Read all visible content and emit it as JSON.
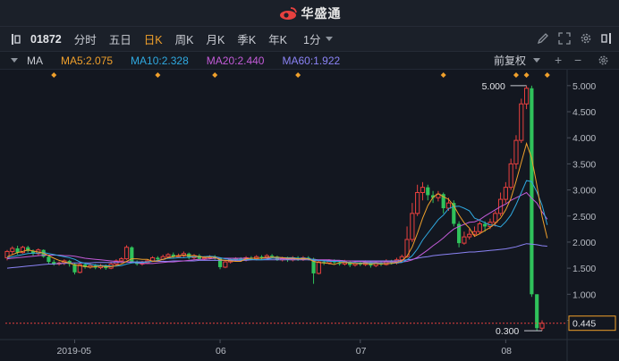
{
  "app": {
    "brand_name": "华盛通"
  },
  "toolbar": {
    "code": "01872",
    "timeframes": [
      "分时",
      "五日",
      "日K",
      "周K",
      "月K",
      "季K",
      "年K"
    ],
    "active_timeframe": "日K",
    "interval": "1分"
  },
  "indicator_bar": {
    "title": "MA",
    "ma5": "MA5:2.075",
    "ma10": "MA10:2.328",
    "ma20": "MA20:2.440",
    "ma60": "MA60:1.922",
    "adjust": "前复权",
    "plus": "+",
    "minus": "−"
  },
  "colors": {
    "up": "#e8413f",
    "down": "#30c25b",
    "ma5": "#f0a02b",
    "ma10": "#2fa9e0",
    "ma20": "#c35bd8",
    "ma60": "#8b83f5",
    "marker": "#f0a02b"
  },
  "chart_data": {
    "type": "candlestick",
    "x_ticks": [
      "2019-05",
      "06",
      "07",
      "08"
    ],
    "y_ticks": [
      "5.000",
      "4.500",
      "4.000",
      "3.500",
      "3.000",
      "2.500",
      "2.000",
      "1.500",
      "1.000",
      "0.500"
    ],
    "ylim": [
      0.2,
      5.1
    ],
    "high_label": "5.000",
    "low_label": "0.300",
    "last_price": "0.445",
    "candles": [
      [
        1.7,
        1.82,
        1.85,
        1.65
      ],
      [
        1.82,
        1.88,
        1.92,
        1.75
      ],
      [
        1.88,
        1.8,
        1.93,
        1.76
      ],
      [
        1.8,
        1.9,
        1.93,
        1.78
      ],
      [
        1.9,
        1.83,
        1.93,
        1.8
      ],
      [
        1.83,
        1.78,
        1.86,
        1.74
      ],
      [
        1.78,
        1.85,
        1.88,
        1.74
      ],
      [
        1.85,
        1.72,
        1.86,
        1.7
      ],
      [
        1.72,
        1.62,
        1.75,
        1.58
      ],
      [
        1.62,
        1.58,
        1.66,
        1.55
      ],
      [
        1.58,
        1.6,
        1.63,
        1.55
      ],
      [
        1.6,
        1.64,
        1.67,
        1.56
      ],
      [
        1.64,
        1.58,
        1.66,
        1.53
      ],
      [
        1.58,
        1.42,
        1.6,
        1.38
      ],
      [
        1.42,
        1.57,
        1.61,
        1.4
      ],
      [
        1.57,
        1.52,
        1.6,
        1.49
      ],
      [
        1.52,
        1.55,
        1.59,
        1.49
      ],
      [
        1.55,
        1.51,
        1.58,
        1.48
      ],
      [
        1.51,
        1.55,
        1.58,
        1.48
      ],
      [
        1.55,
        1.5,
        1.57,
        1.47
      ],
      [
        1.5,
        1.58,
        1.62,
        1.48
      ],
      [
        1.58,
        1.64,
        1.67,
        1.55
      ],
      [
        1.64,
        1.68,
        1.71,
        1.6
      ],
      [
        1.68,
        1.9,
        1.94,
        1.66
      ],
      [
        1.9,
        1.62,
        1.92,
        1.6
      ],
      [
        1.62,
        1.58,
        1.65,
        1.55
      ],
      [
        1.58,
        1.6,
        1.64,
        1.55
      ],
      [
        1.6,
        1.64,
        1.67,
        1.58
      ],
      [
        1.64,
        1.7,
        1.73,
        1.62
      ],
      [
        1.7,
        1.67,
        1.73,
        1.64
      ],
      [
        1.67,
        1.72,
        1.76,
        1.65
      ],
      [
        1.72,
        1.76,
        1.79,
        1.69
      ],
      [
        1.76,
        1.72,
        1.8,
        1.7
      ],
      [
        1.72,
        1.74,
        1.78,
        1.7
      ],
      [
        1.74,
        1.78,
        1.82,
        1.71
      ],
      [
        1.78,
        1.7,
        1.8,
        1.67
      ],
      [
        1.7,
        1.74,
        1.77,
        1.67
      ],
      [
        1.74,
        1.68,
        1.77,
        1.66
      ],
      [
        1.68,
        1.7,
        1.73,
        1.65
      ],
      [
        1.7,
        1.72,
        1.75,
        1.67
      ],
      [
        1.72,
        1.69,
        1.75,
        1.66
      ],
      [
        1.69,
        1.52,
        1.7,
        1.48
      ],
      [
        1.52,
        1.62,
        1.66,
        1.5
      ],
      [
        1.62,
        1.66,
        1.69,
        1.59
      ],
      [
        1.66,
        1.68,
        1.71,
        1.63
      ],
      [
        1.68,
        1.66,
        1.71,
        1.63
      ],
      [
        1.66,
        1.7,
        1.73,
        1.63
      ],
      [
        1.7,
        1.68,
        1.73,
        1.65
      ],
      [
        1.68,
        1.72,
        1.75,
        1.65
      ],
      [
        1.72,
        1.7,
        1.75,
        1.67
      ],
      [
        1.7,
        1.74,
        1.77,
        1.67
      ],
      [
        1.74,
        1.72,
        1.77,
        1.69
      ],
      [
        1.72,
        1.66,
        1.74,
        1.64
      ],
      [
        1.66,
        1.69,
        1.72,
        1.63
      ],
      [
        1.69,
        1.66,
        1.72,
        1.62
      ],
      [
        1.66,
        1.7,
        1.73,
        1.63
      ],
      [
        1.7,
        1.67,
        1.73,
        1.64
      ],
      [
        1.67,
        1.7,
        1.73,
        1.64
      ],
      [
        1.7,
        1.68,
        1.73,
        1.65
      ],
      [
        1.68,
        1.4,
        1.7,
        1.2
      ],
      [
        1.4,
        1.62,
        1.66,
        1.38
      ],
      [
        1.62,
        1.6,
        1.65,
        1.56
      ],
      [
        1.6,
        1.64,
        1.67,
        1.57
      ],
      [
        1.64,
        1.61,
        1.67,
        1.58
      ],
      [
        1.61,
        1.58,
        1.64,
        1.55
      ],
      [
        1.58,
        1.62,
        1.66,
        1.55
      ],
      [
        1.62,
        1.56,
        1.64,
        1.52
      ],
      [
        1.56,
        1.6,
        1.64,
        1.53
      ],
      [
        1.6,
        1.57,
        1.63,
        1.54
      ],
      [
        1.57,
        1.61,
        1.65,
        1.54
      ],
      [
        1.61,
        1.55,
        1.63,
        1.51
      ],
      [
        1.55,
        1.6,
        1.63,
        1.52
      ],
      [
        1.6,
        1.57,
        1.63,
        1.54
      ],
      [
        1.57,
        1.63,
        1.67,
        1.55
      ],
      [
        1.63,
        1.6,
        1.66,
        1.57
      ],
      [
        1.6,
        1.66,
        1.7,
        1.57
      ],
      [
        1.66,
        1.72,
        1.76,
        1.63
      ],
      [
        1.72,
        2.05,
        2.3,
        1.7
      ],
      [
        2.05,
        2.55,
        2.75,
        2.0
      ],
      [
        2.55,
        2.95,
        3.1,
        2.5
      ],
      [
        2.95,
        3.05,
        3.15,
        2.8
      ],
      [
        3.05,
        2.9,
        3.1,
        2.8
      ],
      [
        2.9,
        2.85,
        2.98,
        2.75
      ],
      [
        2.85,
        2.92,
        2.98,
        2.78
      ],
      [
        2.92,
        2.65,
        2.95,
        2.55
      ],
      [
        2.65,
        2.75,
        2.85,
        2.6
      ],
      [
        2.75,
        2.35,
        2.8,
        2.3
      ],
      [
        2.35,
        1.98,
        2.4,
        1.9
      ],
      [
        1.98,
        2.1,
        2.2,
        1.95
      ],
      [
        2.1,
        2.15,
        2.25,
        2.05
      ],
      [
        2.15,
        2.2,
        2.3,
        2.1
      ],
      [
        2.2,
        2.35,
        2.4,
        2.15
      ],
      [
        2.35,
        2.3,
        2.4,
        2.2
      ],
      [
        2.3,
        2.38,
        2.45,
        2.25
      ],
      [
        2.38,
        2.55,
        2.6,
        2.3
      ],
      [
        2.55,
        2.82,
        2.95,
        2.5
      ],
      [
        2.82,
        3.05,
        3.15,
        2.75
      ],
      [
        3.05,
        3.5,
        3.6,
        3.0
      ],
      [
        3.5,
        3.95,
        4.05,
        3.4
      ],
      [
        3.95,
        4.65,
        4.75,
        3.9
      ],
      [
        4.65,
        4.95,
        5.0,
        4.55
      ],
      [
        4.95,
        1.0,
        5.0,
        0.95
      ],
      [
        1.0,
        0.35,
        1.0,
        0.3
      ],
      [
        0.35,
        0.445,
        0.5,
        0.3
      ]
    ],
    "ma_series": {
      "ma5": [
        1.72,
        1.76,
        1.8,
        1.82,
        1.85,
        1.83,
        1.81,
        1.79,
        1.74,
        1.69,
        1.65,
        1.62,
        1.6,
        1.56,
        1.55,
        1.53,
        1.52,
        1.53,
        1.54,
        1.53,
        1.53,
        1.55,
        1.58,
        1.63,
        1.68,
        1.68,
        1.67,
        1.67,
        1.63,
        1.64,
        1.67,
        1.7,
        1.72,
        1.74,
        1.75,
        1.74,
        1.74,
        1.72,
        1.71,
        1.71,
        1.71,
        1.66,
        1.65,
        1.64,
        1.63,
        1.63,
        1.68,
        1.69,
        1.69,
        1.69,
        1.71,
        1.71,
        1.71,
        1.7,
        1.69,
        1.69,
        1.68,
        1.68,
        1.68,
        1.63,
        1.61,
        1.6,
        1.59,
        1.57,
        1.61,
        1.61,
        1.6,
        1.59,
        1.59,
        1.59,
        1.58,
        1.59,
        1.58,
        1.59,
        1.59,
        1.61,
        1.64,
        1.73,
        1.91,
        2.17,
        2.46,
        2.7,
        2.86,
        2.93,
        2.87,
        2.82,
        2.7,
        2.52,
        2.37,
        2.27,
        2.11,
        2.16,
        2.22,
        2.28,
        2.36,
        2.46,
        2.62,
        2.84,
        3.17,
        3.53,
        3.89,
        3.61,
        3.09,
        2.49,
        2.075
      ],
      "ma10": [
        1.7,
        1.72,
        1.74,
        1.76,
        1.78,
        1.79,
        1.79,
        1.8,
        1.78,
        1.76,
        1.74,
        1.72,
        1.7,
        1.67,
        1.62,
        1.59,
        1.57,
        1.56,
        1.55,
        1.55,
        1.54,
        1.54,
        1.55,
        1.58,
        1.6,
        1.61,
        1.61,
        1.62,
        1.63,
        1.65,
        1.67,
        1.69,
        1.69,
        1.7,
        1.7,
        1.71,
        1.72,
        1.72,
        1.72,
        1.73,
        1.72,
        1.7,
        1.68,
        1.67,
        1.67,
        1.67,
        1.67,
        1.67,
        1.66,
        1.66,
        1.67,
        1.69,
        1.7,
        1.7,
        1.7,
        1.7,
        1.69,
        1.69,
        1.69,
        1.66,
        1.65,
        1.64,
        1.63,
        1.63,
        1.63,
        1.62,
        1.61,
        1.61,
        1.6,
        1.6,
        1.6,
        1.6,
        1.59,
        1.59,
        1.59,
        1.6,
        1.61,
        1.66,
        1.74,
        1.87,
        2.04,
        2.17,
        2.3,
        2.43,
        2.52,
        2.64,
        2.68,
        2.69,
        2.65,
        2.6,
        2.46,
        2.42,
        2.37,
        2.33,
        2.32,
        2.29,
        2.39,
        2.52,
        2.72,
        2.95,
        3.18,
        3.16,
        2.96,
        2.71,
        2.328
      ],
      "ma20": [
        1.68,
        1.69,
        1.7,
        1.71,
        1.72,
        1.73,
        1.74,
        1.75,
        1.75,
        1.75,
        1.75,
        1.74,
        1.74,
        1.73,
        1.71,
        1.69,
        1.68,
        1.67,
        1.66,
        1.65,
        1.64,
        1.63,
        1.62,
        1.62,
        1.61,
        1.6,
        1.59,
        1.59,
        1.59,
        1.6,
        1.61,
        1.62,
        1.62,
        1.63,
        1.64,
        1.65,
        1.66,
        1.67,
        1.67,
        1.68,
        1.69,
        1.69,
        1.69,
        1.69,
        1.69,
        1.69,
        1.69,
        1.69,
        1.69,
        1.69,
        1.69,
        1.69,
        1.69,
        1.68,
        1.68,
        1.68,
        1.68,
        1.68,
        1.68,
        1.67,
        1.66,
        1.66,
        1.66,
        1.65,
        1.65,
        1.64,
        1.64,
        1.63,
        1.63,
        1.62,
        1.62,
        1.62,
        1.62,
        1.62,
        1.62,
        1.62,
        1.62,
        1.63,
        1.66,
        1.71,
        1.78,
        1.85,
        1.93,
        2.0,
        2.08,
        2.17,
        2.25,
        2.3,
        2.34,
        2.38,
        2.39,
        2.43,
        2.5,
        2.56,
        2.62,
        2.68,
        2.73,
        2.8,
        2.85,
        2.9,
        2.95,
        2.84,
        2.75,
        2.58,
        2.44
      ],
      "ma60": [
        1.5,
        1.51,
        1.52,
        1.53,
        1.54,
        1.55,
        1.56,
        1.57,
        1.58,
        1.58,
        1.59,
        1.59,
        1.6,
        1.6,
        1.6,
        1.6,
        1.6,
        1.61,
        1.61,
        1.61,
        1.61,
        1.61,
        1.62,
        1.62,
        1.62,
        1.62,
        1.62,
        1.62,
        1.63,
        1.63,
        1.63,
        1.63,
        1.64,
        1.64,
        1.64,
        1.64,
        1.64,
        1.65,
        1.65,
        1.65,
        1.65,
        1.65,
        1.65,
        1.65,
        1.65,
        1.65,
        1.65,
        1.66,
        1.66,
        1.66,
        1.66,
        1.66,
        1.66,
        1.66,
        1.66,
        1.66,
        1.66,
        1.66,
        1.66,
        1.65,
        1.65,
        1.65,
        1.65,
        1.65,
        1.65,
        1.64,
        1.64,
        1.64,
        1.64,
        1.64,
        1.64,
        1.64,
        1.64,
        1.64,
        1.64,
        1.64,
        1.65,
        1.66,
        1.67,
        1.69,
        1.71,
        1.72,
        1.74,
        1.75,
        1.76,
        1.77,
        1.78,
        1.79,
        1.8,
        1.81,
        1.81,
        1.82,
        1.83,
        1.84,
        1.85,
        1.86,
        1.87,
        1.89,
        1.91,
        1.94,
        1.97,
        1.96,
        1.95,
        1.93,
        1.922
      ]
    },
    "event_markers": [
      9,
      29,
      40,
      56,
      84,
      98,
      100,
      104
    ],
    "x_tick_index": [
      13,
      41,
      68,
      96
    ]
  }
}
